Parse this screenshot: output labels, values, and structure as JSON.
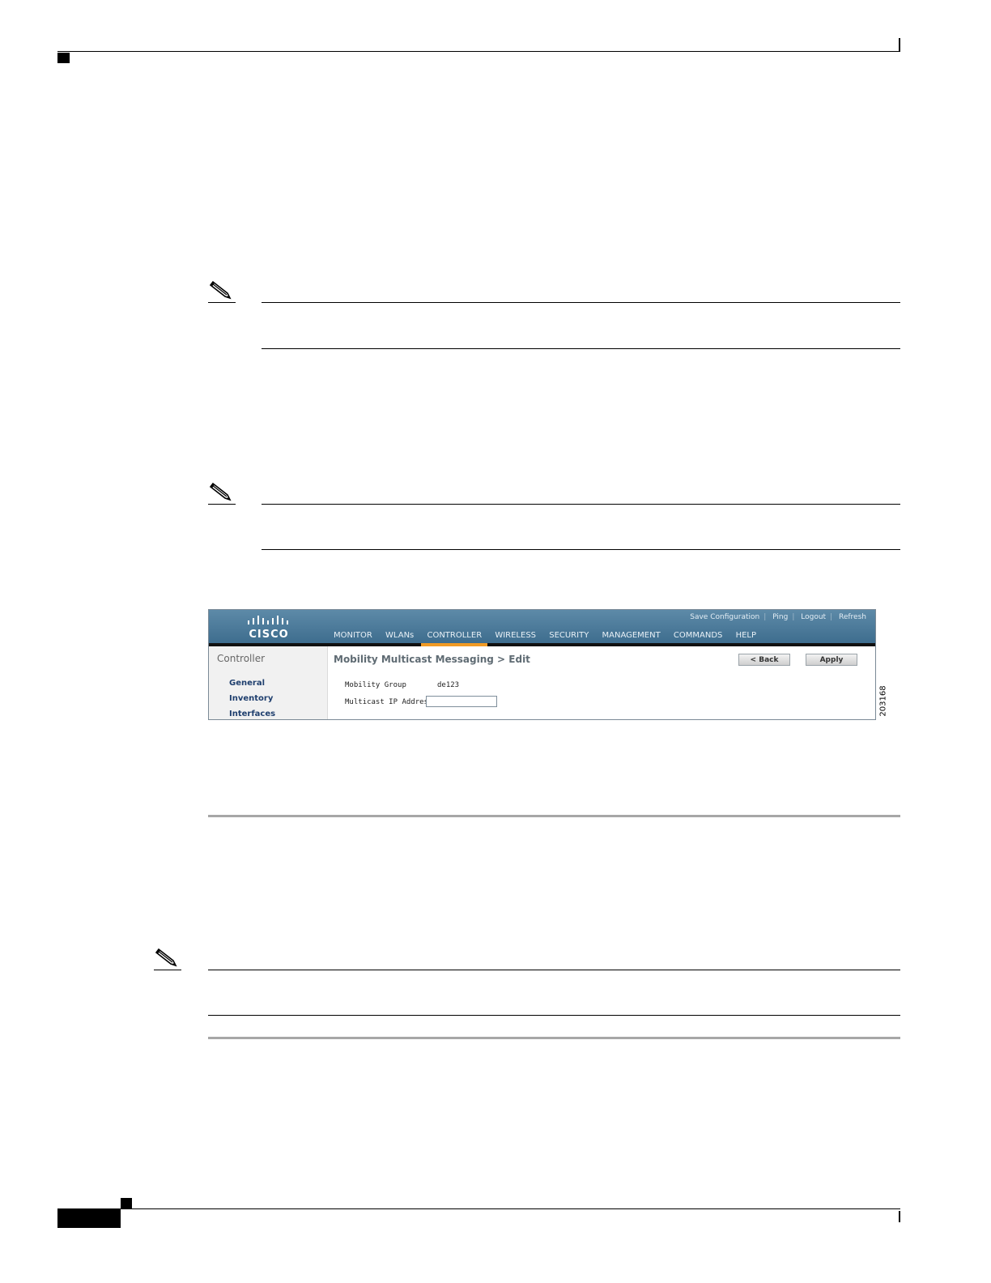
{
  "figure": {
    "figure_id": "203168",
    "screenshot": {
      "header_links": [
        "Save Configuration",
        "Ping",
        "Logout",
        "Refresh"
      ],
      "logo_text": "CISCO",
      "nav_items": [
        "MONITOR",
        "WLANs",
        "CONTROLLER",
        "WIRELESS",
        "SECURITY",
        "MANAGEMENT",
        "COMMANDS",
        "HELP"
      ],
      "active_nav": "CONTROLLER",
      "sidebar": {
        "title": "Controller",
        "items": [
          "General",
          "Inventory",
          "Interfaces"
        ]
      },
      "page_title": "Mobility Multicast Messaging > Edit",
      "back_button": "< Back",
      "apply_button": "Apply",
      "fields": [
        {
          "label": "Mobility Group",
          "value": "de123"
        },
        {
          "label": "Multicast IP Address",
          "value": ""
        }
      ]
    }
  }
}
